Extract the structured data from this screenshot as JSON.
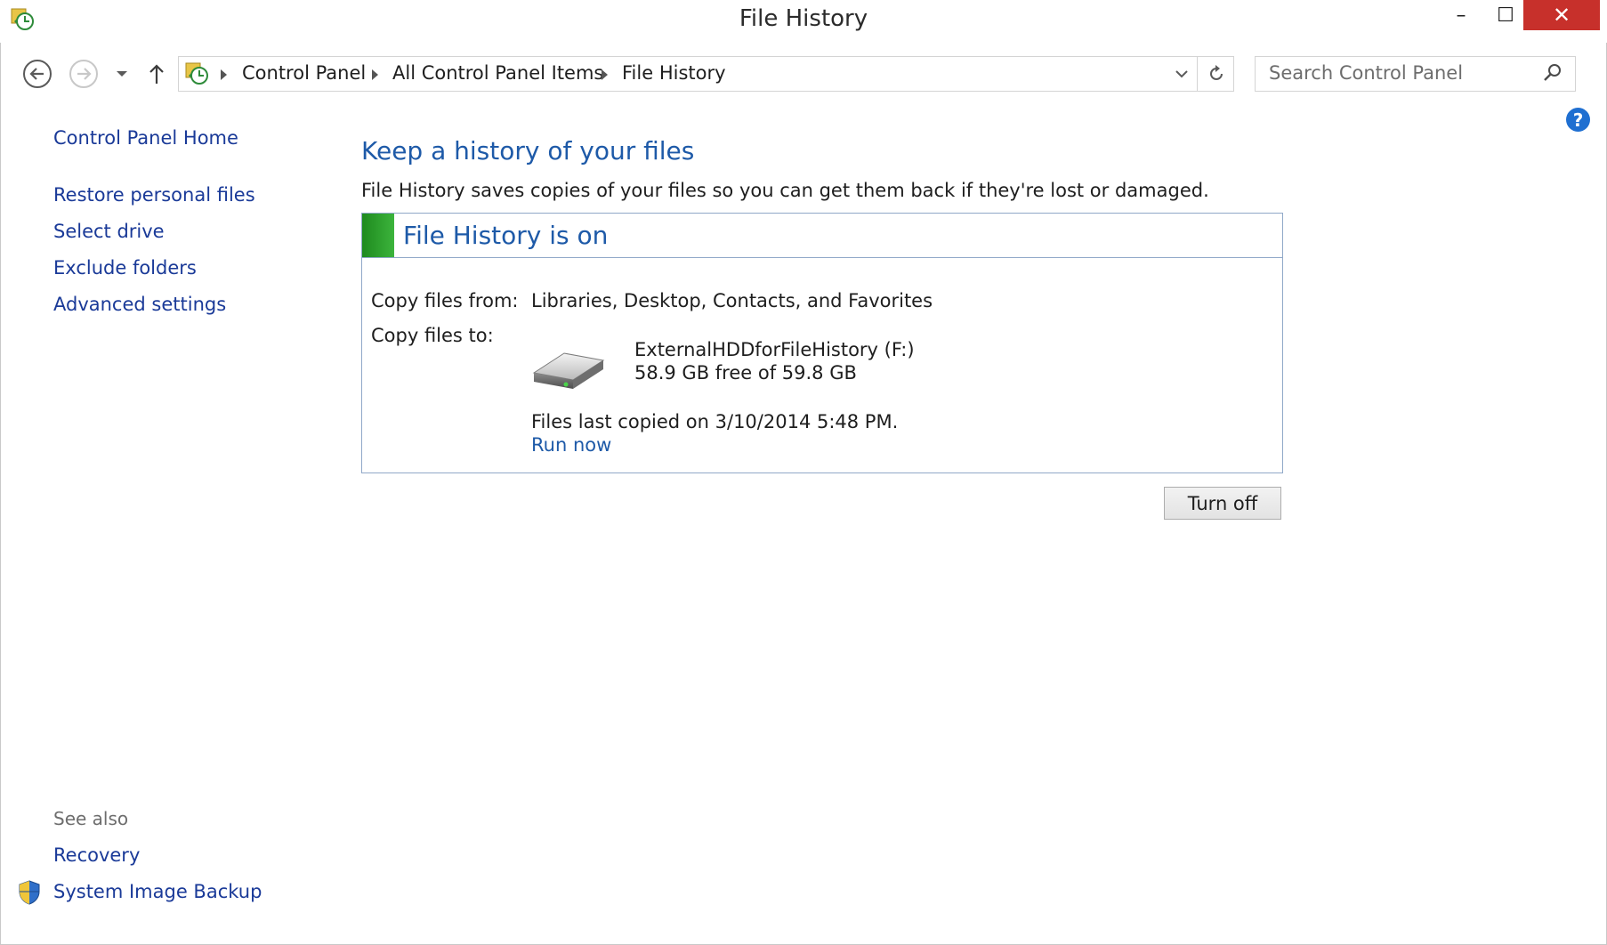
{
  "window": {
    "title": "File History",
    "minimize_glyph": "–",
    "maximize_glyph": "☐",
    "close_glyph": "✕"
  },
  "address": {
    "crumbs": [
      "Control Panel",
      "All Control Panel Items",
      "File History"
    ]
  },
  "search": {
    "placeholder": "Search Control Panel"
  },
  "sidebar": {
    "home": "Control Panel Home",
    "items": [
      {
        "label": "Restore personal files"
      },
      {
        "label": "Select drive"
      },
      {
        "label": "Exclude folders"
      },
      {
        "label": "Advanced settings"
      }
    ],
    "see_also_label": "See also",
    "see_also": [
      {
        "label": "Recovery"
      },
      {
        "label": "System Image Backup"
      }
    ]
  },
  "main": {
    "heading": "Keep a history of your files",
    "description": "File History saves copies of your files so you can get them back if they're lost or damaged.",
    "status": "File History is on",
    "copy_from_label": "Copy files from:",
    "copy_from_value": "Libraries, Desktop, Contacts, and Favorites",
    "copy_to_label": "Copy files to:",
    "drive_name": "ExternalHDDforFileHistory (F:)",
    "drive_space": "58.9 GB free of 59.8 GB",
    "last_copied": "Files last copied on 3/10/2014 5:48 PM.",
    "run_now": "Run now",
    "turn_off": "Turn off"
  },
  "help_glyph": "?",
  "colors": {
    "link": "#1a3a98",
    "heading": "#1e5aa8",
    "status_on": "#2ea02e",
    "close_button": "#c7302b"
  },
  "icons": [
    "file-history-app-icon",
    "back-arrow-icon",
    "forward-arrow-icon",
    "chevron-down-icon",
    "up-arrow-icon",
    "refresh-icon",
    "search-icon",
    "help-icon",
    "hard-drive-icon",
    "shield-icon"
  ]
}
